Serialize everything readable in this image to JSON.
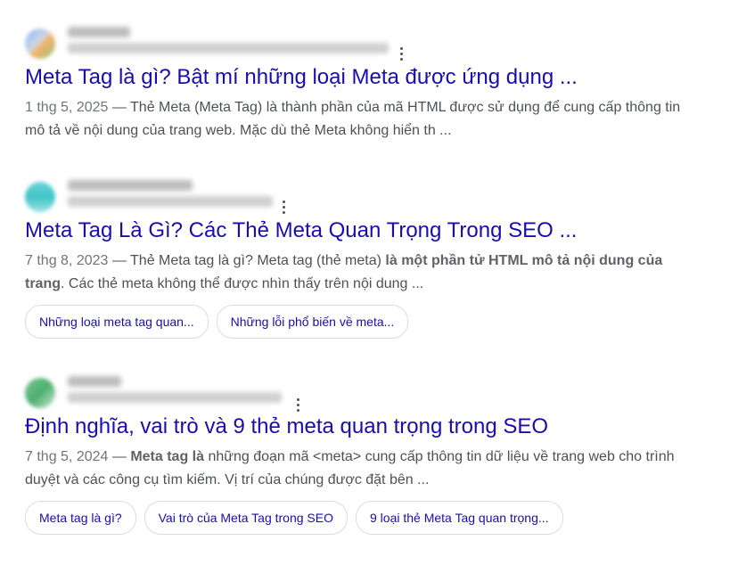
{
  "results": [
    {
      "title": "Meta Tag là gì? Bật mí những loại Meta được ứng dụng ...",
      "snippet": {
        "date": "1 thg 5, 2025",
        "sep": " — ",
        "line1": "Thẻ Meta (Meta Tag) là thành phần của mã HTML được sử dụng để cung cấp thông tin",
        "line2": "mô tả về nội dung của trang web. Mặc dù thẻ Meta không hiển th ..."
      }
    },
    {
      "title": "Meta Tag Là Gì? Các Thẻ Meta Quan Trọng Trong SEO ...",
      "snippet": {
        "date": "7 thg 8, 2023",
        "sep": " — ",
        "pre": "Thẻ Meta tag là gì? Meta tag (thẻ meta) ",
        "bold1": "là một phần tử HTML mô tả nội dung của",
        "bold2": "trang",
        "post": ". Các thẻ meta không thể được nhìn thấy trên nội dung ..."
      },
      "chips": [
        "Những loại meta tag quan...",
        "Những lỗi phổ biến về meta..."
      ]
    },
    {
      "title": "Định nghĩa, vai trò và 9 thẻ meta quan trọng trong SEO",
      "snippet": {
        "date": "7 thg 5, 2024",
        "sep": " — ",
        "bold": "Meta tag là",
        "rest1": " những đoạn mã <meta> cung cấp thông tin dữ liệu về trang web cho trình",
        "line2": "duyệt và các công cụ tìm kiếm. Vị trí của chúng được đặt bên ..."
      },
      "chips": [
        "Meta tag là gì?",
        "Vai trò của Meta Tag trong SEO",
        "9 loại thẻ Meta Tag quan trọng..."
      ]
    }
  ],
  "colors": {
    "link": "#1a0dab",
    "text": "#4d5156",
    "date": "#70757a",
    "chip_border": "#dadce0"
  },
  "icons": [
    "favicon",
    "more-vert-icon"
  ]
}
